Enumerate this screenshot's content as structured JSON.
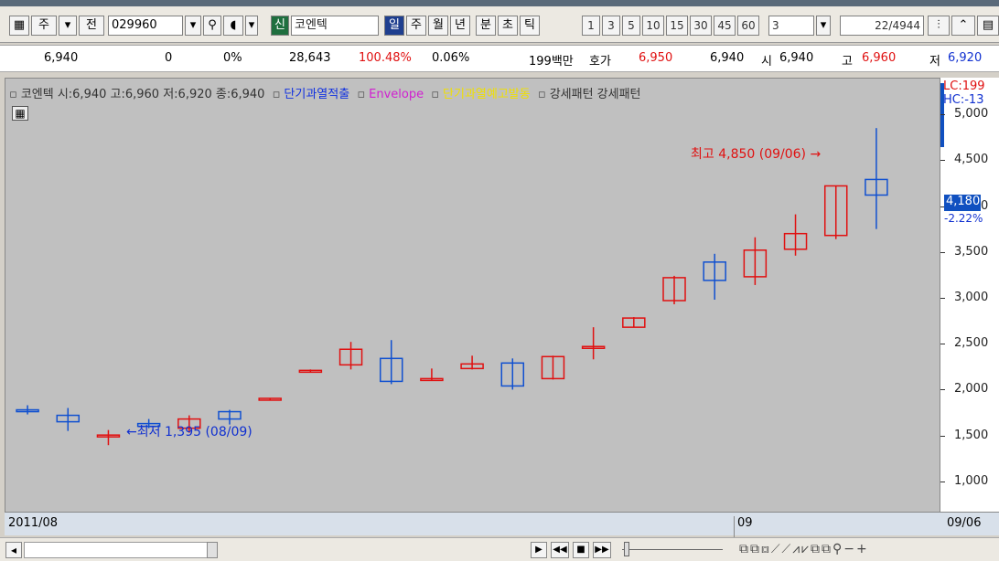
{
  "toolbar": {
    "jongmok_label": "주",
    "jeon_label": "전",
    "code": "029960",
    "sin_label": "신",
    "name": "코엔텍",
    "periods": [
      "일",
      "주",
      "월",
      "년",
      "분",
      "초",
      "틱"
    ],
    "active_period": "일",
    "intervals": [
      "1",
      "3",
      "5",
      "10",
      "15",
      "30",
      "45",
      "60"
    ],
    "count_value": "3",
    "page_indicator": "22/4944"
  },
  "quote": {
    "price": "6,940",
    "change": "0",
    "change_pct": "0%",
    "volume": "28,643",
    "vol_ratio": "100.48%",
    "turnover": "0.06%",
    "amount": "199백만",
    "ask_label": "호가",
    "ask": "6,950",
    "bid": "6,940",
    "open_label": "시",
    "open": "6,940",
    "high_label": "고",
    "high": "6,960",
    "low_label": "저",
    "low": "6,920"
  },
  "legend": {
    "main": "코엔텍 시:6,940 고:6,960 저:6,920 종:6,940",
    "ind1": "단기과열적출",
    "ind2": "Envelope",
    "ind3": "단기과열예고발동",
    "ind4": "강세패턴 강세패턴"
  },
  "axis": {
    "lc": "LC:199",
    "hc": "HC:-13",
    "current": "4,180",
    "current_pct": "-2.22%",
    "start_date": "2011/08",
    "mid_label": "09",
    "end_date": "09/06"
  },
  "annotations": {
    "high": "최고 4,850 (09/06)",
    "low": "최저 1,395 (08/09)"
  },
  "colors": {
    "up": "#e01010",
    "down": "#1050d0",
    "bg": "#c0c0c0"
  },
  "chart_data": {
    "type": "candlestick",
    "ylim": [
      750,
      5250
    ],
    "yticks": [
      "5,000",
      "4,500",
      "4,000",
      "3,500",
      "3,000",
      "2,500",
      "2,000",
      "1,500",
      "1,000"
    ],
    "candles": [
      {
        "o": 1780,
        "h": 1830,
        "l": 1730,
        "c": 1760
      },
      {
        "o": 1720,
        "h": 1800,
        "l": 1550,
        "c": 1650
      },
      {
        "o": 1490,
        "h": 1560,
        "l": 1395,
        "c": 1505
      },
      {
        "o": 1630,
        "h": 1680,
        "l": 1580,
        "c": 1600
      },
      {
        "o": 1580,
        "h": 1720,
        "l": 1530,
        "c": 1680
      },
      {
        "o": 1760,
        "h": 1780,
        "l": 1620,
        "c": 1680
      },
      {
        "o": 1900,
        "h": 1900,
        "l": 1890,
        "c": 1905
      },
      {
        "o": 2200,
        "h": 2220,
        "l": 2190,
        "c": 2210
      },
      {
        "o": 2270,
        "h": 2520,
        "l": 2220,
        "c": 2440
      },
      {
        "o": 2340,
        "h": 2540,
        "l": 2060,
        "c": 2090
      },
      {
        "o": 2110,
        "h": 2230,
        "l": 2100,
        "c": 2120
      },
      {
        "o": 2230,
        "h": 2370,
        "l": 2220,
        "c": 2280
      },
      {
        "o": 2290,
        "h": 2340,
        "l": 2000,
        "c": 2040
      },
      {
        "o": 2120,
        "h": 2370,
        "l": 2110,
        "c": 2360
      },
      {
        "o": 2460,
        "h": 2680,
        "l": 2330,
        "c": 2470
      },
      {
        "o": 2680,
        "h": 2790,
        "l": 2680,
        "c": 2780
      },
      {
        "o": 2970,
        "h": 3240,
        "l": 2930,
        "c": 3220
      },
      {
        "o": 3390,
        "h": 3480,
        "l": 2980,
        "c": 3190
      },
      {
        "o": 3230,
        "h": 3660,
        "l": 3140,
        "c": 3520
      },
      {
        "o": 3530,
        "h": 3910,
        "l": 3460,
        "c": 3700
      },
      {
        "o": 3680,
        "h": 4220,
        "l": 3640,
        "c": 4220
      },
      {
        "o": 4290,
        "h": 4850,
        "l": 3750,
        "c": 4120
      }
    ]
  }
}
